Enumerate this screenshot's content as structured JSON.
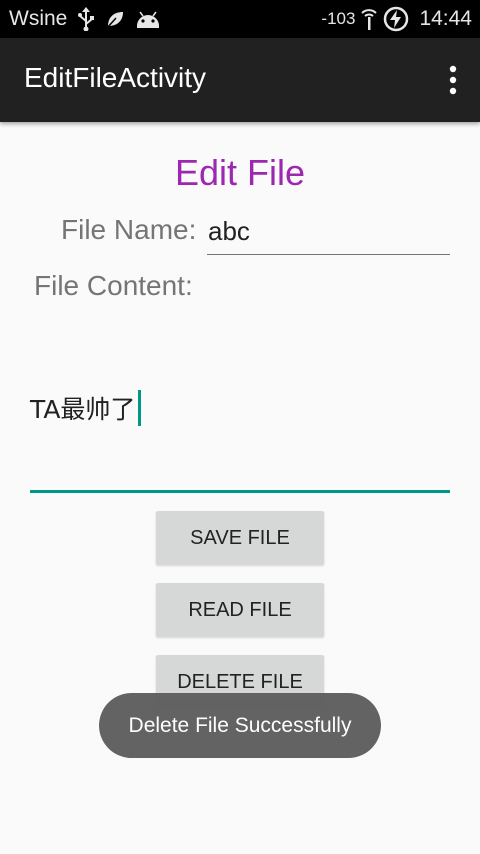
{
  "status_bar": {
    "carrier": "Wsine",
    "icons": [
      "usb-icon",
      "leaf-icon",
      "android-debug-icon"
    ],
    "signal": "-103",
    "time": "14:44"
  },
  "app_bar": {
    "title": "EditFileActivity",
    "overflow_icon": "more-vert-icon"
  },
  "form": {
    "heading": "Edit File",
    "file_name_label": "File Name:",
    "file_name_value": "abc",
    "file_content_label": "File Content:",
    "file_content_value": "TA最帅了"
  },
  "buttons": {
    "save": "SAVE FILE",
    "read": "READ FILE",
    "delete": "DELETE FILE"
  },
  "toast": {
    "message": "Delete File Successfully"
  },
  "colors": {
    "heading": "#9c27b0",
    "accent": "#009688",
    "app_bar": "#212121"
  }
}
